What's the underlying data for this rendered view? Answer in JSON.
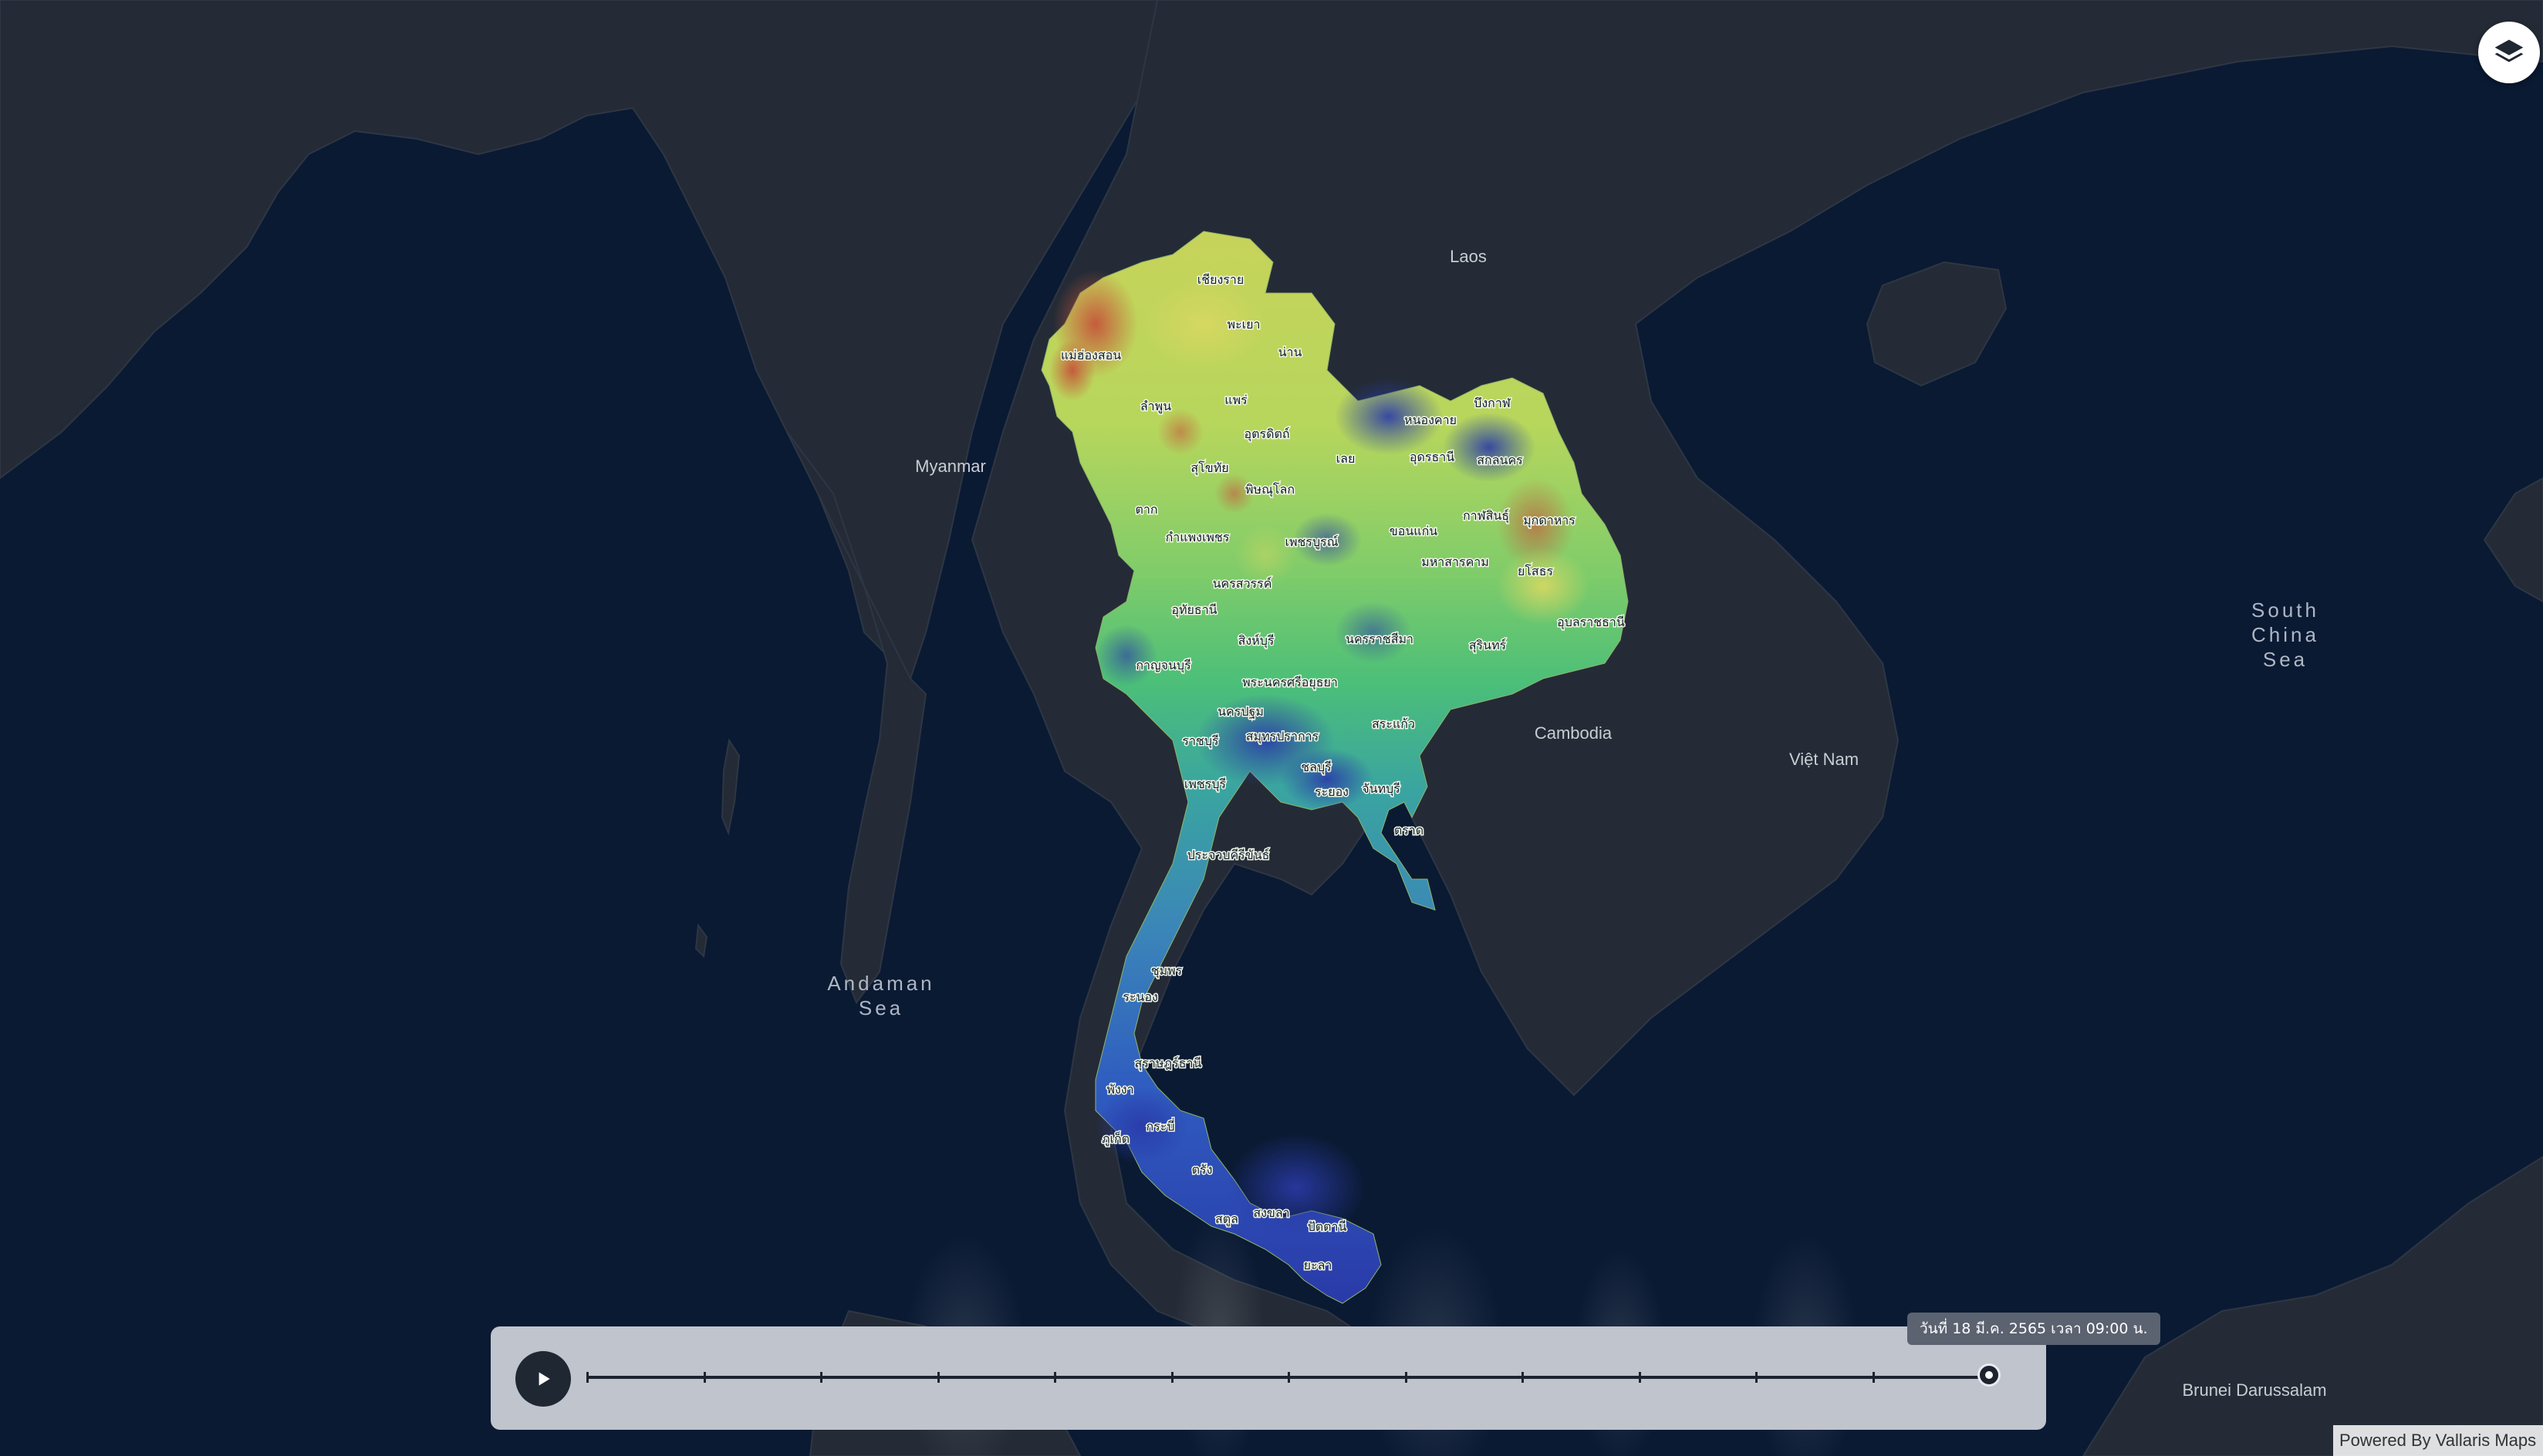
{
  "colors": {
    "ocean": "#0a1a33",
    "land": "#242b36",
    "heat_low": "#2a3fb8",
    "heat_mid": "#5cc77a",
    "heat_high": "#d4d65a",
    "heat_max": "#c0553a"
  },
  "map": {
    "countries": [
      "Laos",
      "Myanmar",
      "Cambodia",
      "Việt Nam",
      "Brunei Darussalam"
    ],
    "seas": {
      "andaman": [
        "Andaman",
        "Sea"
      ],
      "south_china": [
        "South",
        "China",
        "Sea"
      ]
    },
    "provinces": [
      "เชียงราย",
      "พะเยา",
      "แม่ฮ่องสอน",
      "น่าน",
      "ลำพูน",
      "แพร่",
      "อุตรดิตถ์",
      "สุโขทัย",
      "พิษณุโลก",
      "ตาก",
      "กำแพงเพชร",
      "เพชรบูรณ์",
      "นครสวรรค์",
      "อุทัยธานี",
      "สิงห์บุรี",
      "กาญจนบุรี",
      "พระนครศรีอยุธยา",
      "นครปฐม",
      "ราชบุรี",
      "สมุทรปราการ",
      "เพชรบุรี",
      "ประจวบคีรีขันธ์",
      "ชุมพร",
      "ระนอง",
      "สุราษฎร์ธานี",
      "พังงา",
      "กระบี่",
      "ภูเก็ต",
      "ตรัง",
      "สตูล",
      "สงขลา",
      "ปัตตานี",
      "ยะลา",
      "บึงกาฬ",
      "หนองคาย",
      "อุดรธานี",
      "สกลนคร",
      "เลย",
      "กาฬสินธุ์",
      "มุกดาหาร",
      "ขอนแก่น",
      "มหาสารคาม",
      "ยโสธร",
      "อุบลราชธานี",
      "นครราชสีมา",
      "สุรินทร์",
      "สระแก้ว",
      "ชลบุรี",
      "ระยอง",
      "จันทบุรี",
      "ตราด"
    ]
  },
  "layer_button": {
    "icon": "layers-icon"
  },
  "timeline": {
    "play_icon": "play-icon",
    "current_label": "วันที่ 18 มี.ค. 2565 เวลา 09:00 น.",
    "tick_count": 12,
    "progress": 1.0
  },
  "attribution": "Powered By Vallaris Maps"
}
